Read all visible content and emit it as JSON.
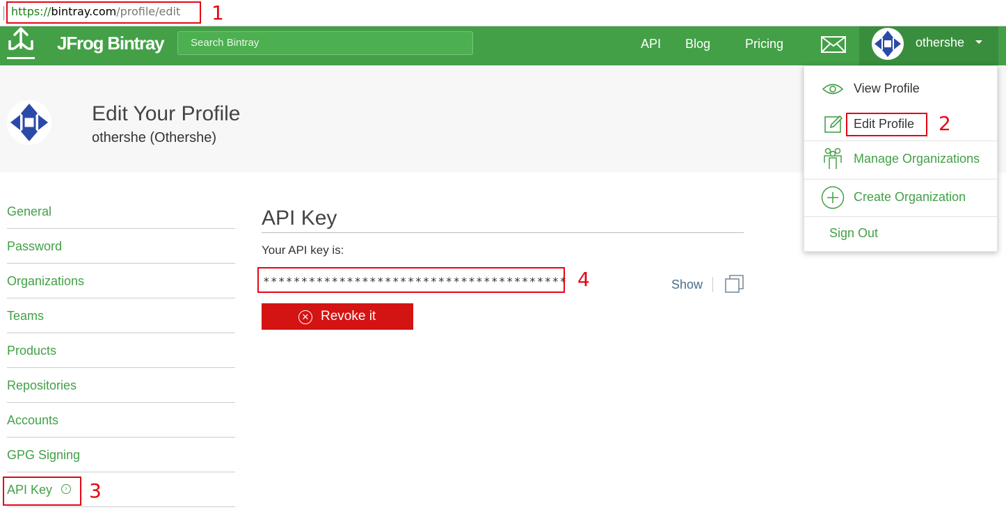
{
  "browser": {
    "url_scheme": "https://",
    "url_domain": "bintray.com",
    "url_path": "/profile/edit"
  },
  "annotations": {
    "n1": "1",
    "n2": "2",
    "n3": "3",
    "n4": "4"
  },
  "navbar": {
    "logo_text": "JFrog Bintray",
    "search_placeholder": "Search Bintray",
    "links": {
      "api": "API",
      "blog": "Blog",
      "pricing": "Pricing"
    },
    "user_name": "othershe",
    "brand_color": "#43a047"
  },
  "dropdown": {
    "view_profile": "View Profile",
    "edit_profile": "Edit Profile",
    "manage_organizations": "Manage Organizations",
    "create_organization": "Create Organization",
    "sign_out": "Sign Out"
  },
  "header": {
    "title": "Edit Your Profile",
    "subtitle": "othershe (Othershe)"
  },
  "sidebar": {
    "items": [
      {
        "label": "General"
      },
      {
        "label": "Password"
      },
      {
        "label": "Organizations"
      },
      {
        "label": "Teams"
      },
      {
        "label": "Products"
      },
      {
        "label": "Repositories"
      },
      {
        "label": "Accounts"
      },
      {
        "label": "GPG Signing"
      },
      {
        "label": "API Key"
      }
    ]
  },
  "main": {
    "title": "API Key",
    "label": "Your API key is:",
    "masked_key": "****************************************",
    "show_label": "Show",
    "revoke_label": "Revoke it",
    "revoke_color": "#d41313"
  }
}
